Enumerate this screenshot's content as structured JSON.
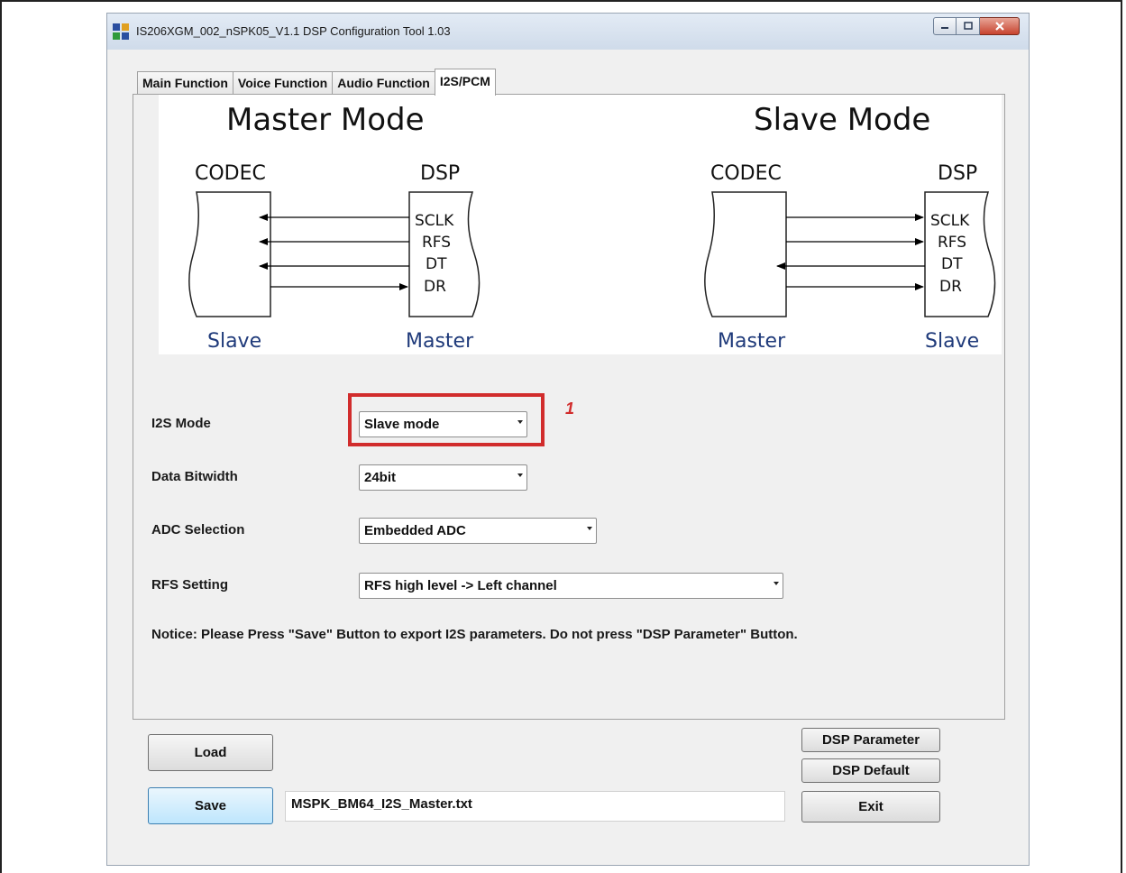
{
  "window": {
    "title": "IS206XGM_002_nSPK05_V1.1 DSP Configuration Tool 1.03"
  },
  "tabs": [
    {
      "label": "Main Function",
      "active": false
    },
    {
      "label": "Voice Function",
      "active": false
    },
    {
      "label": "Audio Function",
      "active": false
    },
    {
      "label": "I2S/PCM",
      "active": true
    }
  ],
  "diagram": {
    "master_mode": {
      "title": "Master Mode",
      "left_label": "CODEC",
      "right_label": "DSP",
      "signals": [
        "SCLK",
        "RFS",
        "DT",
        "DR"
      ],
      "left_role": "Slave",
      "right_role": "Master"
    },
    "slave_mode": {
      "title": "Slave Mode",
      "left_label": "CODEC",
      "right_label": "DSP",
      "signals": [
        "SCLK",
        "RFS",
        "DT",
        "DR"
      ],
      "left_role": "Master",
      "right_role": "Slave"
    }
  },
  "settings": {
    "i2s_mode": {
      "label": "I2S Mode",
      "value": "Slave mode"
    },
    "data_bitwidth": {
      "label": "Data Bitwidth",
      "value": "24bit"
    },
    "adc_selection": {
      "label": "ADC Selection",
      "value": "Embedded ADC"
    },
    "rfs_setting": {
      "label": "RFS Setting",
      "value": "RFS high level -> Left channel"
    }
  },
  "annotation": {
    "number": "1"
  },
  "notice": "Notice:  Please Press \"Save\" Button to export I2S parameters. Do not press \"DSP Parameter\" Button.",
  "buttons": {
    "load": "Load",
    "save": "Save",
    "dsp_parameter": "DSP Parameter",
    "dsp_default": "DSP Default",
    "exit": "Exit"
  },
  "filename": "MSPK_BM64_I2S_Master.txt",
  "colors": {
    "highlight": "#d12c2c",
    "role_label": "#1f3a7a"
  }
}
